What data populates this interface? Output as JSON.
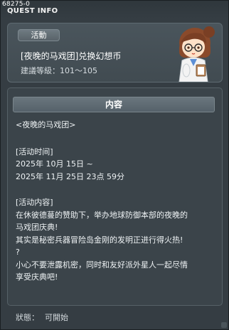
{
  "window": {
    "id": "68275-0",
    "title": "QUEST INFO"
  },
  "header": {
    "badge": "活動",
    "quest_name": "[夜晚的马戏团]兑换幻想币",
    "level": "建議等級：101～105",
    "npc_icon": "npc-girl-portrait"
  },
  "content": {
    "section_title": "内容",
    "lines": [
      "<夜晚的马戏团>",
      "",
      "[活动时间]",
      "2025年 10月 15日 ~",
      "2025年 11月 25日 23点 59分",
      "",
      "[活动内容]",
      "在休彼德蔓的赞助下，举办地球防御本部的夜晚的",
      "马戏团庆典!",
      "其实是秘密兵器冒险岛金刚的发明正进行得火热!",
      "?",
      "小心不要泄露机密，同时和友好派外星人一起尽情",
      "享受庆典吧!"
    ]
  },
  "status": {
    "label": "狀態：",
    "value": "可開始"
  },
  "colors": {
    "window_bg": "#353d43",
    "panel_bg": "#414b51",
    "text": "#eef2f4",
    "title_accent": "#ffffff"
  }
}
